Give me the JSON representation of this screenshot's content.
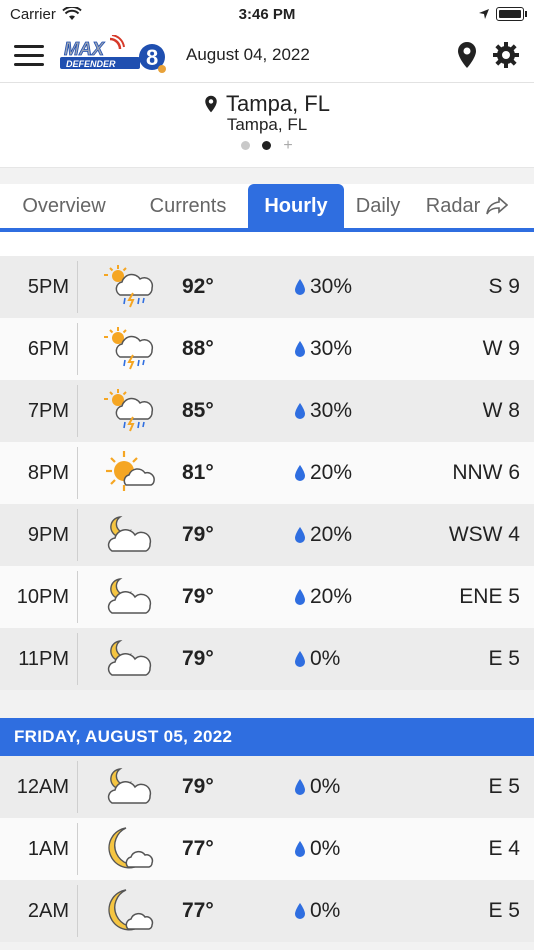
{
  "status": {
    "carrier": "Carrier",
    "time": "3:46 PM"
  },
  "header": {
    "date": "August 04, 2022"
  },
  "location": {
    "name": "Tampa, FL",
    "sub": "Tampa, FL"
  },
  "tabs": [
    {
      "label": "Overview"
    },
    {
      "label": "Currents"
    },
    {
      "label": "Hourly"
    },
    {
      "label": "Daily"
    },
    {
      "label": "Radar"
    }
  ],
  "today_rows": [
    {
      "time": "5PM",
      "icon": "thunderstorm-icon",
      "temp": "92°",
      "precip": "30%",
      "wind": "S 9"
    },
    {
      "time": "6PM",
      "icon": "thunderstorm-icon",
      "temp": "88°",
      "precip": "30%",
      "wind": "W 9"
    },
    {
      "time": "7PM",
      "icon": "thunderstorm-icon",
      "temp": "85°",
      "precip": "30%",
      "wind": "W 8"
    },
    {
      "time": "8PM",
      "icon": "partly-sunny-icon",
      "temp": "81°",
      "precip": "20%",
      "wind": "NNW 6"
    },
    {
      "time": "9PM",
      "icon": "partly-cloudy-night-icon",
      "temp": "79°",
      "precip": "20%",
      "wind": "WSW 4"
    },
    {
      "time": "10PM",
      "icon": "partly-cloudy-night-icon",
      "temp": "79°",
      "precip": "20%",
      "wind": "ENE 5"
    },
    {
      "time": "11PM",
      "icon": "partly-cloudy-night-icon",
      "temp": "79°",
      "precip": "0%",
      "wind": "E 5"
    }
  ],
  "next_day": {
    "header": "FRIDAY, AUGUST 05, 2022"
  },
  "next_rows": [
    {
      "time": "12AM",
      "icon": "partly-cloudy-night-icon",
      "temp": "79°",
      "precip": "0%",
      "wind": "E 5"
    },
    {
      "time": "1AM",
      "icon": "moon-cloud-icon",
      "temp": "77°",
      "precip": "0%",
      "wind": "E 4"
    },
    {
      "time": "2AM",
      "icon": "moon-cloud-icon",
      "temp": "77°",
      "precip": "0%",
      "wind": "E 5"
    }
  ],
  "colors": {
    "accent": "#2f6ee0",
    "sun": "#f5a623",
    "drop": "#2f6ee0"
  }
}
